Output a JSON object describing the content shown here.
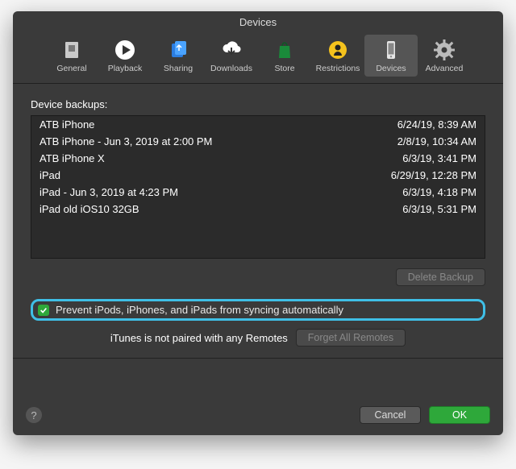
{
  "window": {
    "title": "Devices"
  },
  "toolbar": {
    "items": [
      {
        "label": "General"
      },
      {
        "label": "Playback"
      },
      {
        "label": "Sharing"
      },
      {
        "label": "Downloads"
      },
      {
        "label": "Store"
      },
      {
        "label": "Restrictions"
      },
      {
        "label": "Devices"
      },
      {
        "label": "Advanced"
      }
    ]
  },
  "body": {
    "section_label": "Device backups:",
    "backups": [
      {
        "name": "ATB iPhone",
        "date": "6/24/19, 8:39 AM"
      },
      {
        "name": "ATB iPhone - Jun 3, 2019 at 2:00 PM",
        "date": "2/8/19, 10:34 AM"
      },
      {
        "name": "ATB iPhone X",
        "date": "6/3/19, 3:41 PM"
      },
      {
        "name": "iPad",
        "date": "6/29/19, 12:28 PM"
      },
      {
        "name": "iPad - Jun 3, 2019 at 4:23 PM",
        "date": "6/3/19, 4:18 PM"
      },
      {
        "name": "iPad old iOS10 32GB",
        "date": "6/3/19, 5:31 PM"
      }
    ],
    "delete_label": "Delete Backup",
    "prevent_sync": {
      "checked": true,
      "label": "Prevent iPods, iPhones, and iPads from syncing automatically"
    },
    "remotes": {
      "status": "iTunes is not paired with any Remotes",
      "forget_label": "Forget All Remotes"
    }
  },
  "footer": {
    "help": "?",
    "cancel": "Cancel",
    "ok": "OK"
  },
  "colors": {
    "accent_green": "#2ea83a",
    "highlight": "#3fbfe6"
  }
}
